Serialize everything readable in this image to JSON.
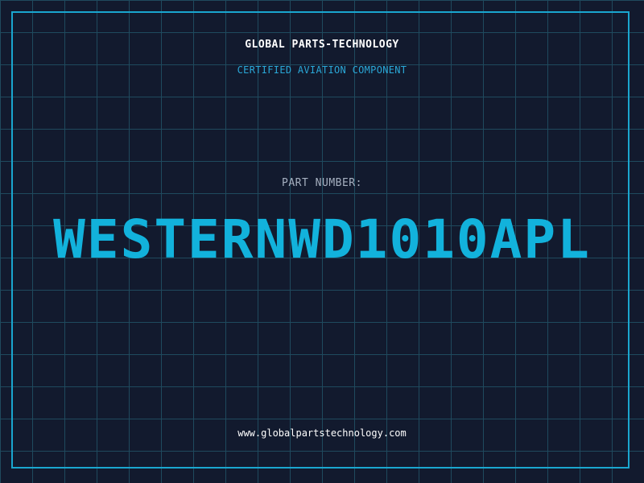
{
  "label": {
    "company": "GLOBAL PARTS-TECHNOLOGY",
    "subtitle": "CERTIFIED AVIATION COMPONENT",
    "part_label": "PART NUMBER:",
    "part_number": "WESTERNWD1010APL",
    "website": "www.globalpartstechnology.com"
  },
  "colors": {
    "background": "#121a2e",
    "grid": "#1f4a5e",
    "frame": "#1aa6cf",
    "accent": "#12b2dc",
    "subtitle": "#2aa8d8",
    "muted": "#a6b0c0",
    "text": "#ffffff"
  }
}
